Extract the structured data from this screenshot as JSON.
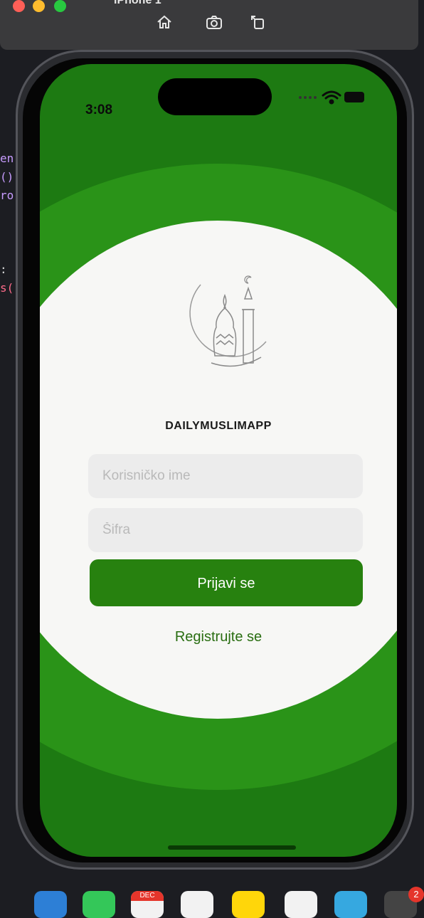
{
  "simulator": {
    "title": "iPhone 1",
    "buttons": [
      "home-icon",
      "screenshot-icon",
      "rotate-icon"
    ]
  },
  "code_peek": [
    "en",
    "()",
    "ro",
    "",
    "",
    "",
    ":",
    "s("
  ],
  "status_bar": {
    "time": "3:08"
  },
  "app": {
    "title": "DAILYMUSLIMAPP",
    "username": {
      "placeholder": "Korisničko ime",
      "value": ""
    },
    "password": {
      "placeholder": "Šifra",
      "value": ""
    },
    "login_label": "Prijavi se",
    "register_label": "Registrujte se"
  },
  "dock": {
    "calendar_month": "DEC",
    "badge_count": "2"
  },
  "colors": {
    "dark_green": "#1d7a12",
    "mid_green": "#2a9318",
    "button_green": "#27810f",
    "link_green": "#2a6e12"
  }
}
